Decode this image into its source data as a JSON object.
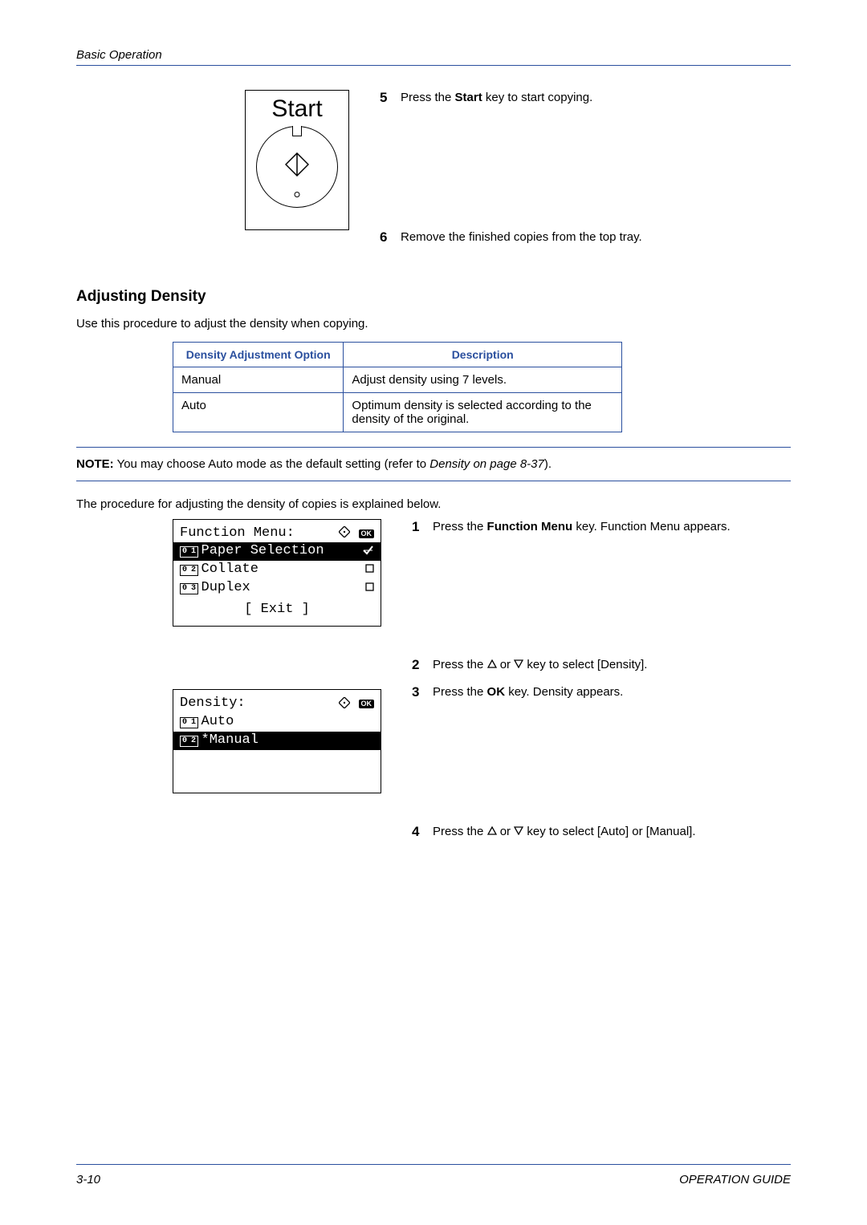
{
  "header": {
    "section": "Basic Operation"
  },
  "start_key": {
    "label": "Start"
  },
  "steps_top": {
    "s5": {
      "num": "5",
      "pre": "Press the ",
      "bold": "Start",
      "post": " key to start copying."
    },
    "s6": {
      "num": "6",
      "text": "Remove the finished copies from the top tray."
    }
  },
  "heading": "Adjusting Density",
  "intro": "Use this procedure to adjust the density when copying.",
  "table": {
    "head_option": "Density Adjustment Option",
    "head_desc": "Description",
    "rows": [
      {
        "opt": "Manual",
        "desc": "Adjust density using 7 levels."
      },
      {
        "opt": "Auto",
        "desc": "Optimum density is selected according to the density of the original."
      }
    ]
  },
  "note": {
    "label": "NOTE:",
    "pre": " You may choose Auto mode as the default setting (refer to ",
    "ref": "Density on page 8-37",
    "post": ")."
  },
  "proc_intro": "The procedure for adjusting the density of copies is explained below.",
  "lcd1": {
    "title": "Function Menu:",
    "ok": "OK",
    "item1_num": "0 1",
    "item1": "Paper Selection",
    "item2_num": "0 2",
    "item2": "Collate",
    "item3_num": "0 3",
    "item3": "Duplex",
    "exit": "[  Exit  ]"
  },
  "lcd2": {
    "title": "Density:",
    "ok": "OK",
    "item1_num": "0 1",
    "item1": "Auto",
    "item2_num": "0 2",
    "item2": "*Manual"
  },
  "steps_proc": {
    "s1": {
      "num": "1",
      "pre": "Press the ",
      "bold": "Function Menu",
      "post": " key. Function Menu appears."
    },
    "s2": {
      "num": "2",
      "pre": "Press the ",
      "mid": " or ",
      "post": " key to select [Density]."
    },
    "s3": {
      "num": "3",
      "pre": "Press the ",
      "bold": "OK",
      "post": " key. Density appears."
    },
    "s4": {
      "num": "4",
      "pre": "Press the ",
      "mid": " or ",
      "post": " key to select [Auto] or [Manual]."
    }
  },
  "footer": {
    "page": "3-10",
    "guide": "OPERATION GUIDE"
  }
}
